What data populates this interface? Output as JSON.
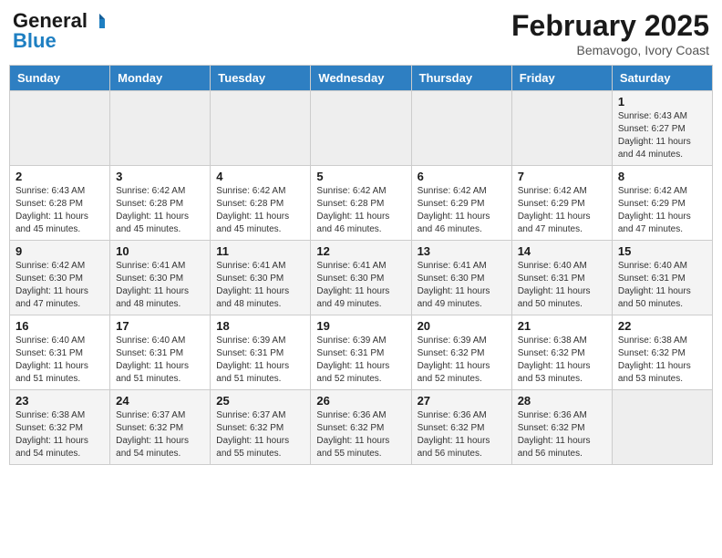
{
  "header": {
    "logo_general": "General",
    "logo_blue": "Blue",
    "month_year": "February 2025",
    "location": "Bemavogo, Ivory Coast"
  },
  "weekdays": [
    "Sunday",
    "Monday",
    "Tuesday",
    "Wednesday",
    "Thursday",
    "Friday",
    "Saturday"
  ],
  "weeks": [
    [
      {
        "day": "",
        "info": ""
      },
      {
        "day": "",
        "info": ""
      },
      {
        "day": "",
        "info": ""
      },
      {
        "day": "",
        "info": ""
      },
      {
        "day": "",
        "info": ""
      },
      {
        "day": "",
        "info": ""
      },
      {
        "day": "1",
        "info": "Sunrise: 6:43 AM\nSunset: 6:27 PM\nDaylight: 11 hours\nand 44 minutes."
      }
    ],
    [
      {
        "day": "2",
        "info": "Sunrise: 6:43 AM\nSunset: 6:28 PM\nDaylight: 11 hours\nand 45 minutes."
      },
      {
        "day": "3",
        "info": "Sunrise: 6:42 AM\nSunset: 6:28 PM\nDaylight: 11 hours\nand 45 minutes."
      },
      {
        "day": "4",
        "info": "Sunrise: 6:42 AM\nSunset: 6:28 PM\nDaylight: 11 hours\nand 45 minutes."
      },
      {
        "day": "5",
        "info": "Sunrise: 6:42 AM\nSunset: 6:28 PM\nDaylight: 11 hours\nand 46 minutes."
      },
      {
        "day": "6",
        "info": "Sunrise: 6:42 AM\nSunset: 6:29 PM\nDaylight: 11 hours\nand 46 minutes."
      },
      {
        "day": "7",
        "info": "Sunrise: 6:42 AM\nSunset: 6:29 PM\nDaylight: 11 hours\nand 47 minutes."
      },
      {
        "day": "8",
        "info": "Sunrise: 6:42 AM\nSunset: 6:29 PM\nDaylight: 11 hours\nand 47 minutes."
      }
    ],
    [
      {
        "day": "9",
        "info": "Sunrise: 6:42 AM\nSunset: 6:30 PM\nDaylight: 11 hours\nand 47 minutes."
      },
      {
        "day": "10",
        "info": "Sunrise: 6:41 AM\nSunset: 6:30 PM\nDaylight: 11 hours\nand 48 minutes."
      },
      {
        "day": "11",
        "info": "Sunrise: 6:41 AM\nSunset: 6:30 PM\nDaylight: 11 hours\nand 48 minutes."
      },
      {
        "day": "12",
        "info": "Sunrise: 6:41 AM\nSunset: 6:30 PM\nDaylight: 11 hours\nand 49 minutes."
      },
      {
        "day": "13",
        "info": "Sunrise: 6:41 AM\nSunset: 6:30 PM\nDaylight: 11 hours\nand 49 minutes."
      },
      {
        "day": "14",
        "info": "Sunrise: 6:40 AM\nSunset: 6:31 PM\nDaylight: 11 hours\nand 50 minutes."
      },
      {
        "day": "15",
        "info": "Sunrise: 6:40 AM\nSunset: 6:31 PM\nDaylight: 11 hours\nand 50 minutes."
      }
    ],
    [
      {
        "day": "16",
        "info": "Sunrise: 6:40 AM\nSunset: 6:31 PM\nDaylight: 11 hours\nand 51 minutes."
      },
      {
        "day": "17",
        "info": "Sunrise: 6:40 AM\nSunset: 6:31 PM\nDaylight: 11 hours\nand 51 minutes."
      },
      {
        "day": "18",
        "info": "Sunrise: 6:39 AM\nSunset: 6:31 PM\nDaylight: 11 hours\nand 51 minutes."
      },
      {
        "day": "19",
        "info": "Sunrise: 6:39 AM\nSunset: 6:31 PM\nDaylight: 11 hours\nand 52 minutes."
      },
      {
        "day": "20",
        "info": "Sunrise: 6:39 AM\nSunset: 6:32 PM\nDaylight: 11 hours\nand 52 minutes."
      },
      {
        "day": "21",
        "info": "Sunrise: 6:38 AM\nSunset: 6:32 PM\nDaylight: 11 hours\nand 53 minutes."
      },
      {
        "day": "22",
        "info": "Sunrise: 6:38 AM\nSunset: 6:32 PM\nDaylight: 11 hours\nand 53 minutes."
      }
    ],
    [
      {
        "day": "23",
        "info": "Sunrise: 6:38 AM\nSunset: 6:32 PM\nDaylight: 11 hours\nand 54 minutes."
      },
      {
        "day": "24",
        "info": "Sunrise: 6:37 AM\nSunset: 6:32 PM\nDaylight: 11 hours\nand 54 minutes."
      },
      {
        "day": "25",
        "info": "Sunrise: 6:37 AM\nSunset: 6:32 PM\nDaylight: 11 hours\nand 55 minutes."
      },
      {
        "day": "26",
        "info": "Sunrise: 6:36 AM\nSunset: 6:32 PM\nDaylight: 11 hours\nand 55 minutes."
      },
      {
        "day": "27",
        "info": "Sunrise: 6:36 AM\nSunset: 6:32 PM\nDaylight: 11 hours\nand 56 minutes."
      },
      {
        "day": "28",
        "info": "Sunrise: 6:36 AM\nSunset: 6:32 PM\nDaylight: 11 hours\nand 56 minutes."
      },
      {
        "day": "",
        "info": ""
      }
    ]
  ]
}
